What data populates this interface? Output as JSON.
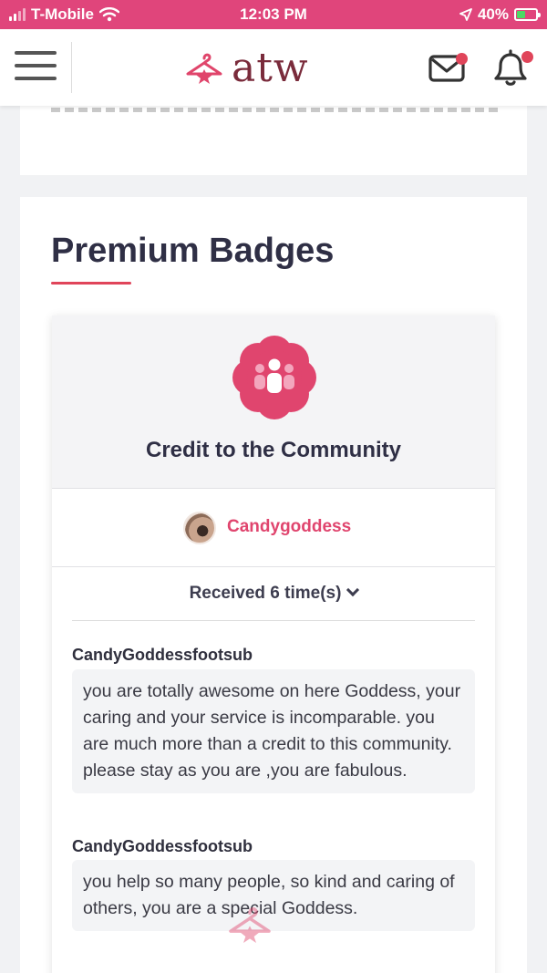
{
  "status_bar": {
    "carrier": "T-Mobile",
    "time": "12:03 PM",
    "battery": "40%"
  },
  "header": {
    "logo_text": "atw",
    "brand_color": "#7a2b3b",
    "accent": "#e0457b"
  },
  "section": {
    "title": "Premium Badges"
  },
  "badge": {
    "name": "Credit to the Community",
    "owner": "Candygoddess",
    "received_label": "Received 6 time(s)",
    "comments": [
      {
        "author": "CandyGoddessfootsub",
        "text": "you are totally awesome on here Goddess, your caring and your service is incomparable. you are much more than a credit to this community. please stay as you are ,you are fabulous."
      },
      {
        "author": "CandyGoddessfootsub",
        "text": "you help so many people, so kind and caring of others, you are a special Goddess."
      }
    ]
  },
  "icons": [
    "menu-icon",
    "mail-icon",
    "bell-icon",
    "hanger-logo-icon",
    "community-badge-icon",
    "chevron-down-icon"
  ]
}
